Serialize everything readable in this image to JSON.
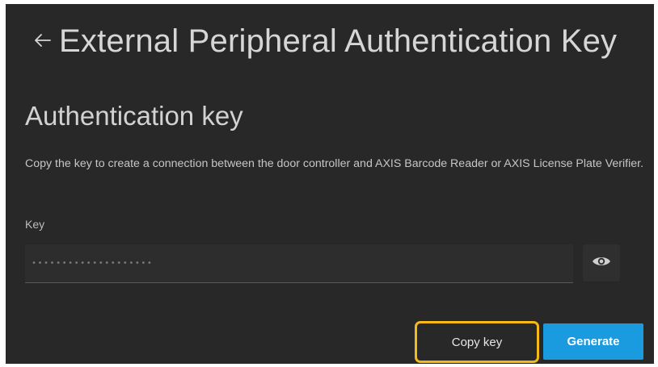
{
  "header": {
    "back_icon": "back-arrow-icon",
    "title": "External Peripheral Authentication Key"
  },
  "section": {
    "title": "Authentication key",
    "description": "Copy the key to create a connection between the door controller and AXIS Barcode Reader or AXIS License Plate Verifier."
  },
  "key_field": {
    "label": "Key",
    "value": "••••••••••••••••••••",
    "visibility_icon": "eye-icon"
  },
  "actions": {
    "copy_label": "Copy key",
    "generate_label": "Generate"
  },
  "colors": {
    "background": "#282828",
    "highlight": "#f5b91a",
    "primary": "#1a9be0"
  }
}
